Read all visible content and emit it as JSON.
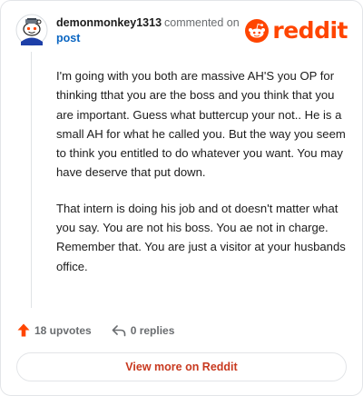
{
  "header": {
    "username": "demonmonkey1313",
    "commented_on": "commented on",
    "post_link": "post"
  },
  "brand": {
    "wordmark": "reddit",
    "color": "#ff4500"
  },
  "comment": {
    "paragraphs": [
      "I'm going with you both are massive AH'S you OP for thinking tthat you are the boss and you think that you are important. Guess what buttercup your not.. He is a small AH for what he called you. But the way you seem to think you entitled to do whatever you want. You may have deserve that put down.",
      "That intern is doing his job and ot doesn't matter what you say. You are not his boss. You ae not in charge. Remember that. You are just a visitor at your husbands office."
    ]
  },
  "actions": {
    "upvotes": "18 upvotes",
    "replies": "0 replies",
    "upvote_icon": "upvote-arrow-icon",
    "reply_icon": "reply-arrow-icon"
  },
  "footer": {
    "view_more": "View more on Reddit"
  }
}
